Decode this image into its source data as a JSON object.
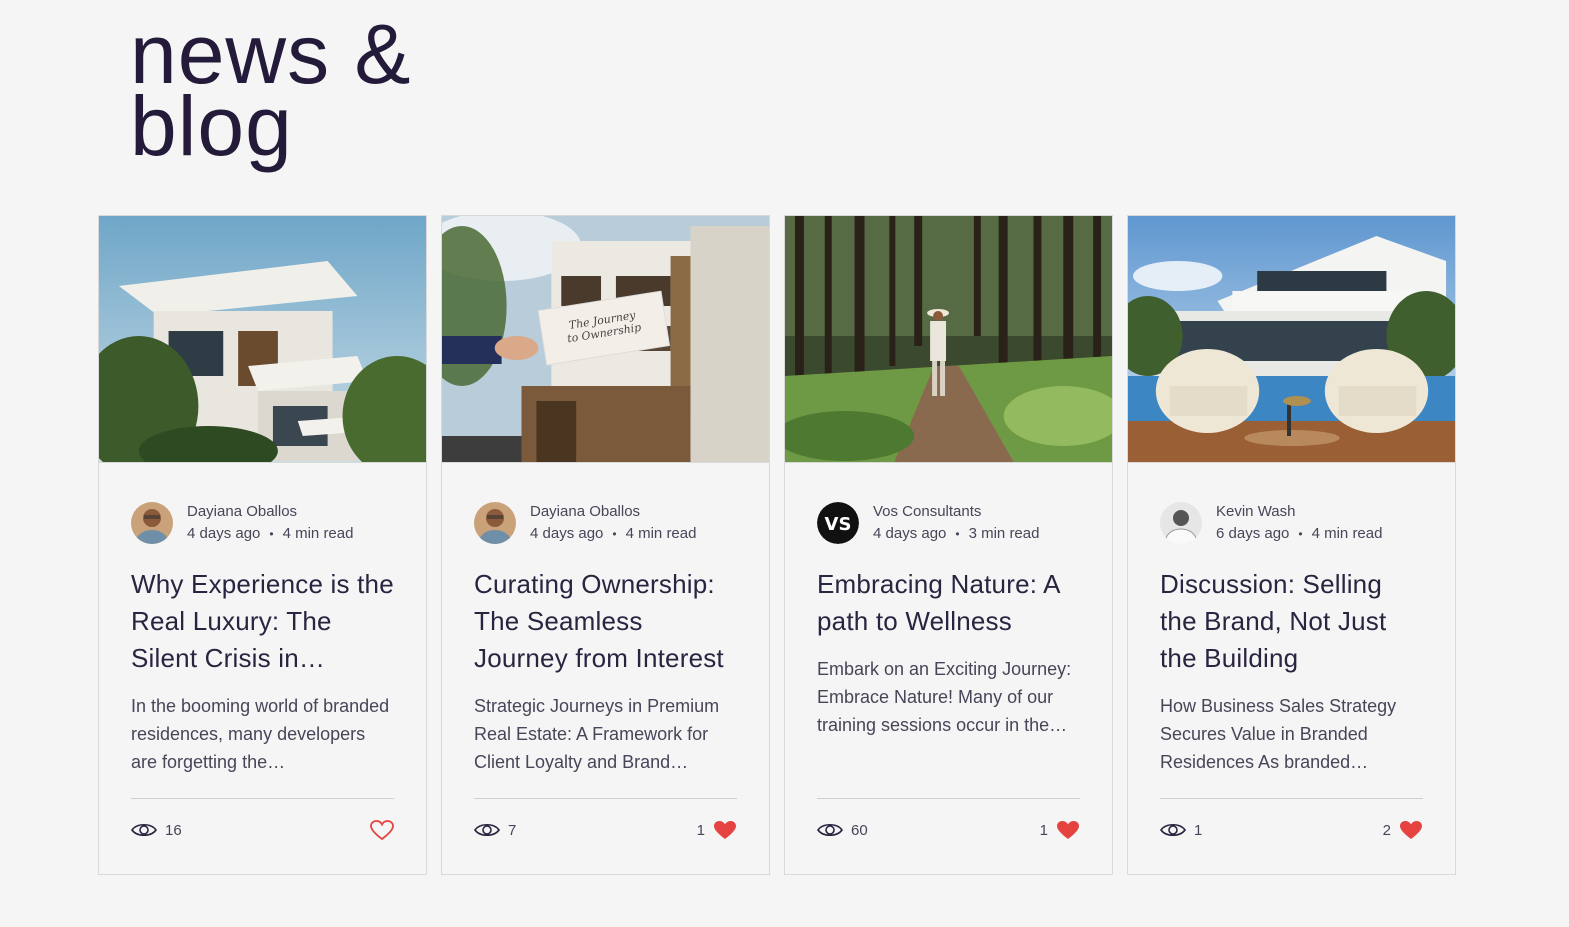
{
  "header": {
    "title_line1": "news &",
    "title_line2": "blog"
  },
  "colors": {
    "heart": "#e5433f",
    "title": "#241a3a",
    "border": "#d9d9d9"
  },
  "posts": [
    {
      "author": "Dayiana Oballos",
      "date": "4 days ago",
      "read_time": "4 min read",
      "title": "Why Experience is the Real Luxury: The Silent Crisis in…",
      "excerpt": "In the booming world of branded residences, many developers are forgetting the…",
      "views": "16",
      "likes": "",
      "liked": false
    },
    {
      "author": "Dayiana Oballos",
      "date": "4 days ago",
      "read_time": "4 min read",
      "title": "Curating Ownership: The Seamless Journey from Interest to…",
      "excerpt": "Strategic Journeys in Premium Real Estate: A Framework for Client Loyalty and Brand…",
      "views": "7",
      "likes": "1",
      "liked": true,
      "image_text": "The Journey to Ownership"
    },
    {
      "author": "Vos Consultants",
      "date": "4 days ago",
      "read_time": "3 min read",
      "title": "Embracing Nature: A path to Wellness",
      "excerpt": "Embark on an Exciting Journey: Embrace Nature! Many of our training sessions occur in the…",
      "views": "60",
      "likes": "1",
      "liked": true
    },
    {
      "author": "Kevin Wash",
      "date": "6 days ago",
      "read_time": "4 min read",
      "title": "Discussion: Selling the Brand, Not Just the Building",
      "excerpt": "How Business Sales Strategy Secures Value in Branded Residences As branded…",
      "views": "1",
      "likes": "2",
      "liked": true
    }
  ]
}
